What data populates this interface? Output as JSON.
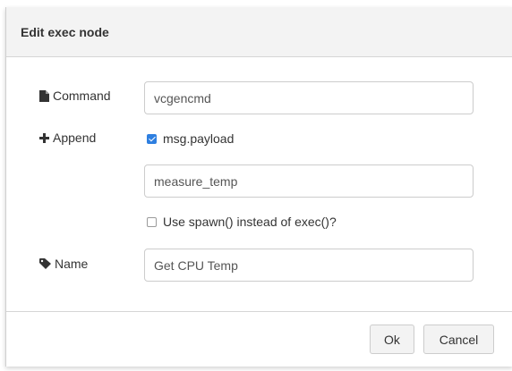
{
  "dialog": {
    "title": "Edit exec node",
    "command": {
      "icon": "file-icon",
      "label": "Command",
      "value": "vcgencmd"
    },
    "append": {
      "icon": "plus-icon",
      "label": "Append",
      "checkbox_label": "msg.payload",
      "checked": true,
      "extra_value": "measure_temp"
    },
    "spawn": {
      "label": "Use spawn() instead of exec()?",
      "checked": false
    },
    "name": {
      "icon": "tag-icon",
      "label": "Name",
      "value": "Get CPU Temp"
    },
    "buttons": {
      "ok": "Ok",
      "cancel": "Cancel"
    }
  },
  "colors": {
    "accent": "#2e7fe0",
    "titlebar_bg": "#f3f3f3",
    "border": "#cccccc",
    "text": "#333333"
  }
}
